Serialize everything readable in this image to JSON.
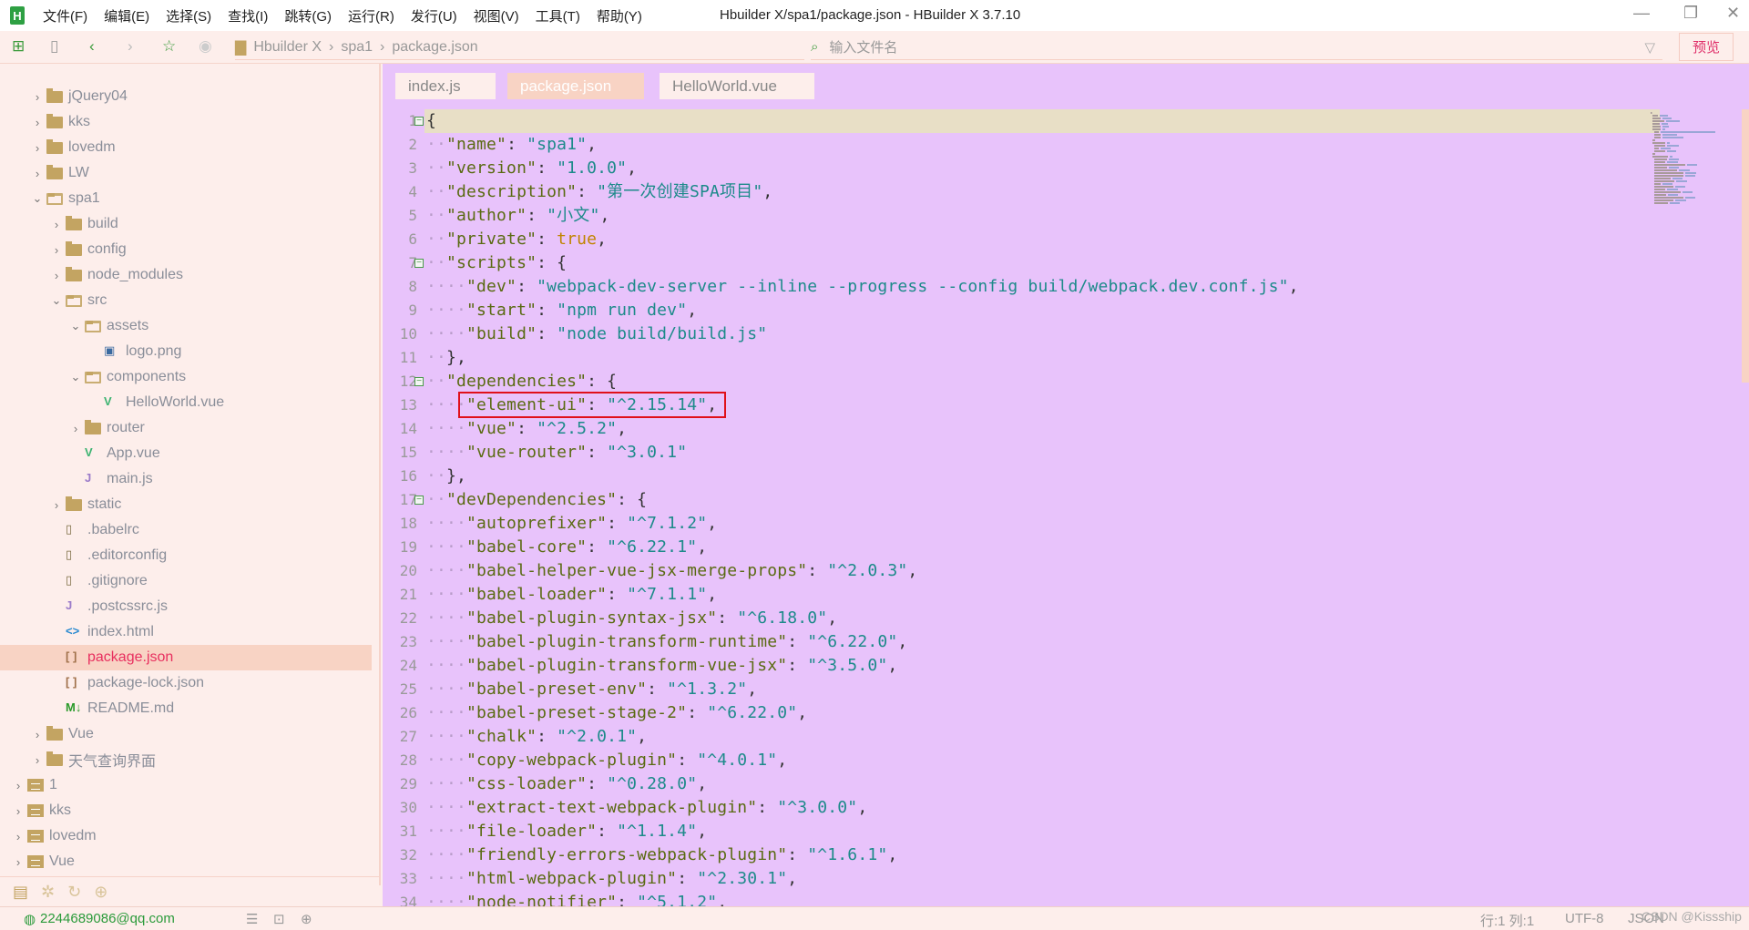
{
  "titlebar": {
    "logo": "H",
    "menu": [
      "文件(F)",
      "编辑(E)",
      "选择(S)",
      "查找(I)",
      "跳转(G)",
      "运行(R)",
      "发行(U)",
      "视图(V)",
      "工具(T)",
      "帮助(Y)"
    ],
    "title": "Hbuilder X/spa1/package.json - HBuilder X 3.7.10"
  },
  "toolbar": {
    "breadcrumb": [
      "Hbuilder X",
      "spa1",
      "package.json"
    ],
    "search_placeholder": "输入文件名",
    "preview_label": "预览"
  },
  "sidebar": {
    "items": [
      {
        "label": "jQuery04",
        "level": 1,
        "type": "folder",
        "expanded": false
      },
      {
        "label": "kks",
        "level": 1,
        "type": "folder",
        "expanded": false
      },
      {
        "label": "lovedm",
        "level": 1,
        "type": "folder",
        "expanded": false
      },
      {
        "label": "LW",
        "level": 1,
        "type": "folder",
        "expanded": false
      },
      {
        "label": "spa1",
        "level": 1,
        "type": "folder",
        "expanded": true
      },
      {
        "label": "build",
        "level": 2,
        "type": "folder",
        "expanded": false
      },
      {
        "label": "config",
        "level": 2,
        "type": "folder",
        "expanded": false
      },
      {
        "label": "node_modules",
        "level": 2,
        "type": "folder",
        "expanded": false
      },
      {
        "label": "src",
        "level": 2,
        "type": "folder",
        "expanded": true
      },
      {
        "label": "assets",
        "level": 3,
        "type": "folder",
        "expanded": true
      },
      {
        "label": "logo.png",
        "level": 4,
        "type": "image"
      },
      {
        "label": "components",
        "level": 3,
        "type": "folder",
        "expanded": true
      },
      {
        "label": "HelloWorld.vue",
        "level": 4,
        "type": "vue"
      },
      {
        "label": "router",
        "level": 3,
        "type": "folder",
        "expanded": false
      },
      {
        "label": "App.vue",
        "level": 3,
        "type": "vue"
      },
      {
        "label": "main.js",
        "level": 3,
        "type": "js"
      },
      {
        "label": "static",
        "level": 2,
        "type": "folder",
        "expanded": false
      },
      {
        "label": ".babelrc",
        "level": 2,
        "type": "file"
      },
      {
        "label": ".editorconfig",
        "level": 2,
        "type": "file"
      },
      {
        "label": ".gitignore",
        "level": 2,
        "type": "file"
      },
      {
        "label": ".postcssrc.js",
        "level": 2,
        "type": "js"
      },
      {
        "label": "index.html",
        "level": 2,
        "type": "html"
      },
      {
        "label": "package.json",
        "level": 2,
        "type": "json",
        "selected": true
      },
      {
        "label": "package-lock.json",
        "level": 2,
        "type": "json"
      },
      {
        "label": "README.md",
        "level": 2,
        "type": "md"
      },
      {
        "label": "Vue",
        "level": 1,
        "type": "folder",
        "expanded": false
      },
      {
        "label": "天气查询界面",
        "level": 1,
        "type": "folder",
        "expanded": false
      },
      {
        "label": "1",
        "level": 0,
        "type": "project",
        "expanded": false
      },
      {
        "label": "kks",
        "level": 0,
        "type": "project",
        "expanded": false
      },
      {
        "label": "lovedm",
        "level": 0,
        "type": "project",
        "expanded": false
      },
      {
        "label": "Vue",
        "level": 0,
        "type": "project",
        "expanded": false
      }
    ]
  },
  "editor": {
    "tabs": [
      {
        "label": "index.js"
      },
      {
        "label": "package.json",
        "active": true
      },
      {
        "label": "HelloWorld.vue"
      }
    ],
    "fold_lines": [
      1,
      7,
      12,
      17
    ],
    "highlighted_line": 13,
    "lines": [
      "{",
      "  \"name\": \"spa1\",",
      "  \"version\": \"1.0.0\",",
      "  \"description\": \"第一次创建SPA项目\",",
      "  \"author\": \"小文\",",
      "  \"private\": true,",
      "  \"scripts\": {",
      "    \"dev\": \"webpack-dev-server --inline --progress --config build/webpack.dev.conf.js\",",
      "    \"start\": \"npm run dev\",",
      "    \"build\": \"node build/build.js\"",
      "  },",
      "  \"dependencies\": {",
      "    \"element-ui\": \"^2.15.14\",",
      "    \"vue\": \"^2.5.2\",",
      "    \"vue-router\": \"^3.0.1\"",
      "  },",
      "  \"devDependencies\": {",
      "    \"autoprefixer\": \"^7.1.2\",",
      "    \"babel-core\": \"^6.22.1\",",
      "    \"babel-helper-vue-jsx-merge-props\": \"^2.0.3\",",
      "    \"babel-loader\": \"^7.1.1\",",
      "    \"babel-plugin-syntax-jsx\": \"^6.18.0\",",
      "    \"babel-plugin-transform-runtime\": \"^6.22.0\",",
      "    \"babel-plugin-transform-vue-jsx\": \"^3.5.0\",",
      "    \"babel-preset-env\": \"^1.3.2\",",
      "    \"babel-preset-stage-2\": \"^6.22.0\",",
      "    \"chalk\": \"^2.0.1\",",
      "    \"copy-webpack-plugin\": \"^4.0.1\",",
      "    \"css-loader\": \"^0.28.0\",",
      "    \"extract-text-webpack-plugin\": \"^3.0.0\",",
      "    \"file-loader\": \"^1.1.4\",",
      "    \"friendly-errors-webpack-plugin\": \"^1.6.1\",",
      "    \"html-webpack-plugin\": \"^2.30.1\",",
      "    \"node-notifier\": \"^5.1.2\","
    ],
    "colors": {
      "key": "#5a6a12",
      "string": "#1d8a8a",
      "boolean": "#c08400",
      "highlight_box": "#e0101a"
    }
  },
  "status": {
    "account": "2244689086@qq.com",
    "position": "行:1  列:1",
    "encoding": "UTF-8",
    "language": "JSON",
    "watermark": "CSDN @Kissship"
  }
}
